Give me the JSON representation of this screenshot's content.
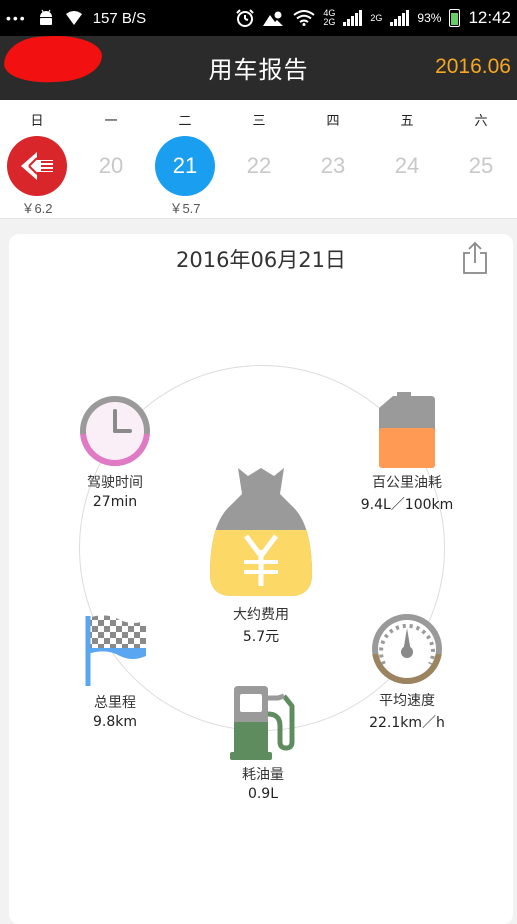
{
  "status_bar": {
    "speed": "157 B/S",
    "signal_4g": "4G",
    "signal_2g_a": "2G",
    "signal_2g_b": "2G",
    "battery": "93%",
    "time": "12:42"
  },
  "header": {
    "title": "用车报告",
    "month": "2016.06"
  },
  "week": {
    "days": [
      {
        "dow": "日",
        "num": "",
        "cost": "￥6.2"
      },
      {
        "dow": "一",
        "num": "20",
        "cost": ""
      },
      {
        "dow": "二",
        "num": "21",
        "cost": "￥5.7"
      },
      {
        "dow": "三",
        "num": "22",
        "cost": ""
      },
      {
        "dow": "四",
        "num": "23",
        "cost": ""
      },
      {
        "dow": "五",
        "num": "24",
        "cost": ""
      },
      {
        "dow": "六",
        "num": "25",
        "cost": ""
      }
    ]
  },
  "report": {
    "date": "2016年06月21日",
    "drive_time": {
      "label": "驾驶时间",
      "value": "27min"
    },
    "fuel_per_100km": {
      "label": "百公里油耗",
      "value": "9.4L／100km"
    },
    "cost": {
      "label": "大约费用",
      "value": "5.7元"
    },
    "mileage": {
      "label": "总里程",
      "value": "9.8km"
    },
    "avg_speed": {
      "label": "平均速度",
      "value": "22.1km／h"
    },
    "fuel_used": {
      "label": "耗油量",
      "value": "0.9L"
    }
  },
  "colors": {
    "header_bg": "#2b2b2b",
    "accent_orange": "#f5a623",
    "selected_blue": "#1a9ef0",
    "logo_red": "#d8262b"
  }
}
